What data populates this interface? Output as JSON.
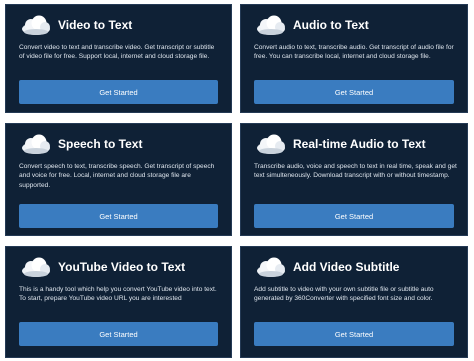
{
  "cards": [
    {
      "title": "Video to Text",
      "description": "Convert video to text and transcribe video. Get transcript or subtitle of video file for free. Support local, internet and cloud storage file.",
      "button": "Get Started",
      "icon": "cloud-icon"
    },
    {
      "title": "Audio to Text",
      "description": "Convert audio to text, transcribe audio. Get transcript of audio file for free. You can transcribe local, internet and cloud storage file.",
      "button": "Get Started",
      "icon": "cloud-icon"
    },
    {
      "title": "Speech to Text",
      "description": "Convert speech to text, transcribe speech. Get transcript of speech and voice for free. Local, internet and cloud storage file are supported.",
      "button": "Get Started",
      "icon": "cloud-icon"
    },
    {
      "title": "Real-time Audio to Text",
      "description": "Transcribe audio, voice and speech to text in real time, speak and get text simulteneously. Download transcript with or without timestamp.",
      "button": "Get Started",
      "icon": "cloud-icon"
    },
    {
      "title": "YouTube Video to Text",
      "description": "This is a handy tool which help you convert YouTube video into text. To start, prepare YouTube video URL you are interested",
      "button": "Get Started",
      "icon": "cloud-icon"
    },
    {
      "title": "Add Video Subtitle",
      "description": "Add subtitle to video with your own subtitle file or subtitle auto generated by 360Converter with specified font size and color.",
      "button": "Get Started",
      "icon": "cloud-icon"
    }
  ],
  "colors": {
    "card_background": "#0f2136",
    "button": "#3a7cc0",
    "title_text": "#ffffff"
  }
}
